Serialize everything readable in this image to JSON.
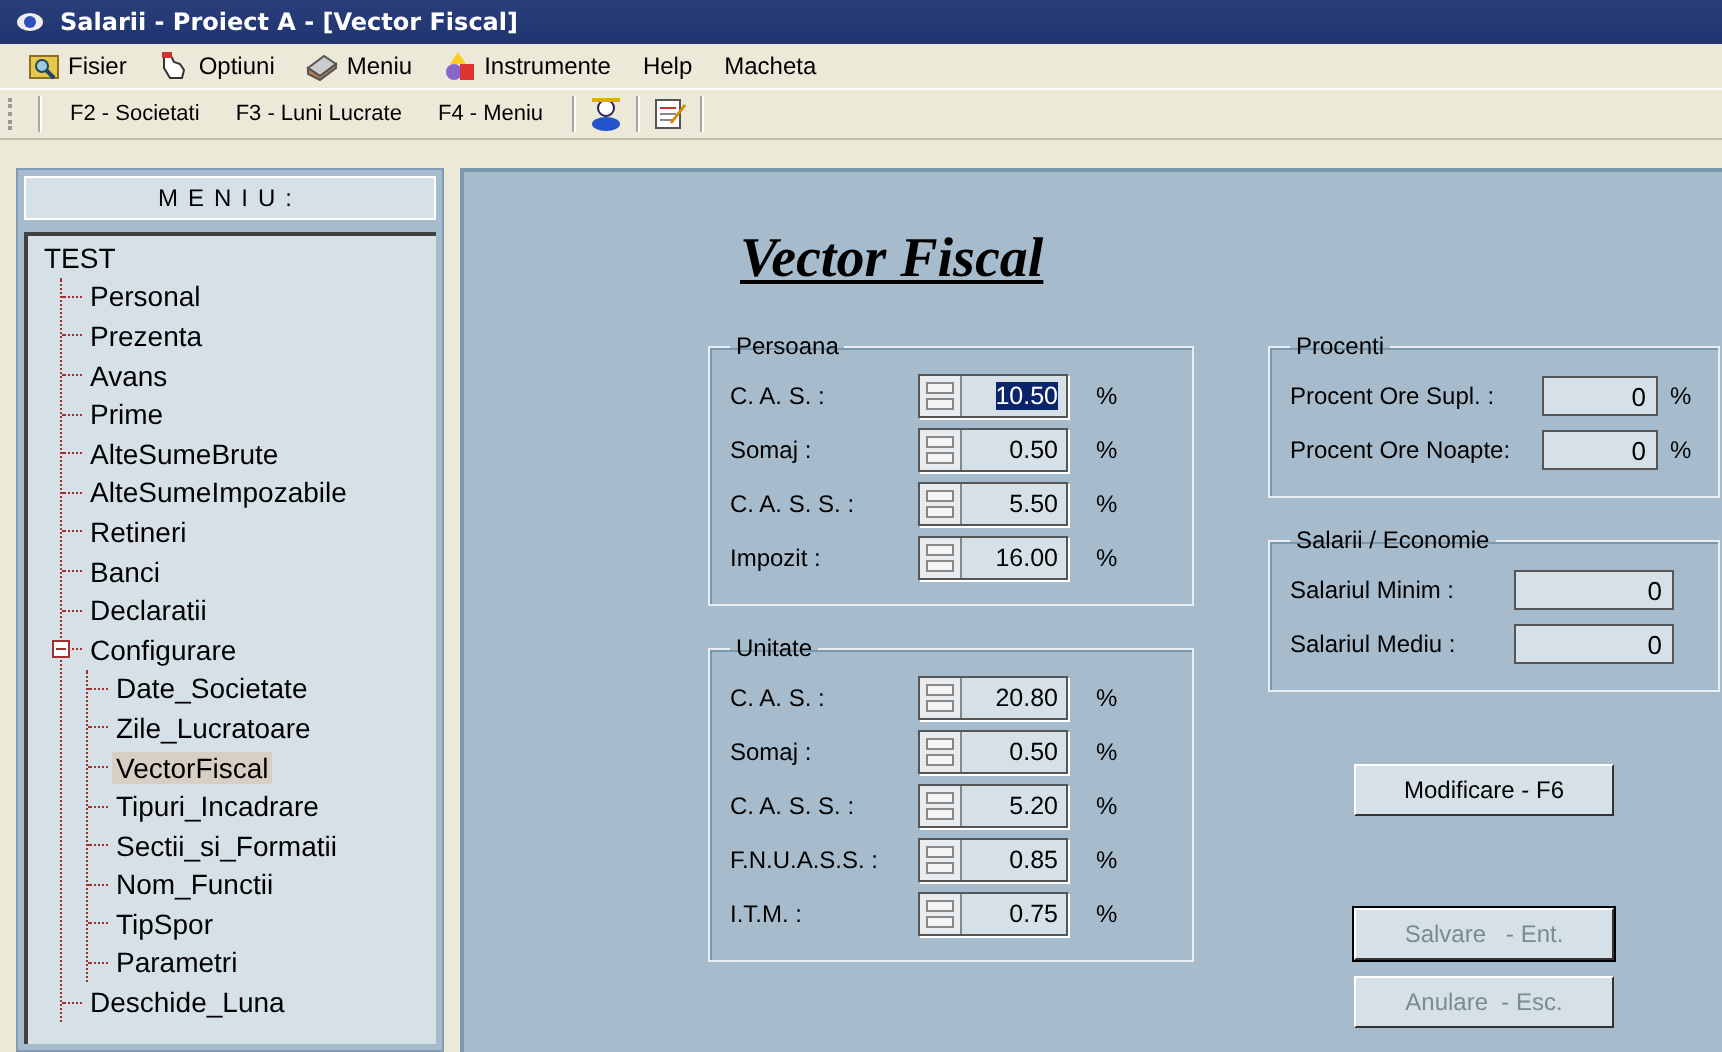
{
  "window": {
    "title": "Salarii - Proiect A  - [Vector Fiscal]"
  },
  "menu": [
    {
      "label": "Fisier",
      "kind": "folder"
    },
    {
      "label": "Optiuni",
      "kind": "hand"
    },
    {
      "label": "Meniu",
      "kind": "book"
    },
    {
      "label": "Instrumente",
      "kind": "shapes"
    },
    {
      "label": "Help",
      "kind": "none"
    },
    {
      "label": "Macheta",
      "kind": "none"
    }
  ],
  "toolbar": [
    {
      "kind": "text",
      "label": "F2 - Societati"
    },
    {
      "kind": "text",
      "label": "F3 - Luni Lucrate"
    },
    {
      "kind": "text",
      "label": "F4 - Meniu"
    },
    {
      "kind": "person"
    },
    {
      "kind": "notepad"
    }
  ],
  "sidebar": {
    "title": "MENIU:",
    "tree": {
      "label": "TEST",
      "children": [
        {
          "label": "Personal",
          "selected": false
        },
        {
          "label": "Prezenta",
          "selected": false
        },
        {
          "label": "Avans",
          "selected": false
        },
        {
          "label": "Prime",
          "selected": false
        },
        {
          "label": "AlteSumeBrute",
          "selected": false
        },
        {
          "label": "AlteSumeImpozabile",
          "selected": false
        },
        {
          "label": "Retineri",
          "selected": false
        },
        {
          "label": "Banci",
          "selected": false
        },
        {
          "label": "Declaratii",
          "selected": false
        },
        {
          "label": "Configurare",
          "selected": false,
          "expanded": true,
          "children": [
            {
              "label": "Date_Societate",
              "selected": false
            },
            {
              "label": "Zile_Lucratoare",
              "selected": false
            },
            {
              "label": "VectorFiscal",
              "selected": true
            },
            {
              "label": "Tipuri_Incadrare",
              "selected": false
            },
            {
              "label": "Sectii_si_Formatii",
              "selected": false
            },
            {
              "label": "Nom_Functii",
              "selected": false
            },
            {
              "label": "TipSpor",
              "selected": false
            },
            {
              "label": "Parametri",
              "selected": false
            }
          ]
        },
        {
          "label": "Deschide_Luna",
          "selected": false
        }
      ]
    }
  },
  "form": {
    "title": "Vector Fiscal",
    "persoana": {
      "title": "Persoana",
      "rows": [
        {
          "label": "C. A. S. :",
          "value": "10.50",
          "unit": "%",
          "focused": true
        },
        {
          "label": "Somaj :",
          "value": "0.50",
          "unit": "%",
          "focused": false
        },
        {
          "label": "C. A. S. S. :",
          "value": "5.50",
          "unit": "%",
          "focused": false
        },
        {
          "label": "Impozit :",
          "value": "16.00",
          "unit": "%",
          "focused": false
        }
      ]
    },
    "unitate": {
      "title": "Unitate",
      "rows": [
        {
          "label": "C. A. S. :",
          "value": "20.80",
          "unit": "%",
          "focused": false
        },
        {
          "label": "Somaj :",
          "value": "0.50",
          "unit": "%",
          "focused": false
        },
        {
          "label": "C. A. S. S. :",
          "value": "5.20",
          "unit": "%",
          "focused": false
        },
        {
          "label": "F.N.U.A.S.S. :",
          "value": "0.85",
          "unit": "%",
          "focused": false
        },
        {
          "label": "I.T.M. :",
          "value": "0.75",
          "unit": "%",
          "focused": false
        }
      ]
    },
    "procenti": {
      "title": "Procenti",
      "rows": [
        {
          "label": "Procent Ore Supl. :",
          "value": "0",
          "unit": "%"
        },
        {
          "label": "Procent Ore Noapte:",
          "value": "0",
          "unit": "%"
        }
      ]
    },
    "salarii": {
      "title": "Salarii / Economie",
      "rows": [
        {
          "label": "Salariul Minim :",
          "value": "0"
        },
        {
          "label": "Salariul Mediu :",
          "value": "0"
        }
      ]
    },
    "buttons": [
      {
        "label": "Modificare - F6",
        "disabled": false,
        "default": false
      },
      {
        "label": "Salvare   - Ent.",
        "disabled": true,
        "default": true
      },
      {
        "label": "Anulare  - Esc.",
        "disabled": true,
        "default": false
      }
    ]
  }
}
